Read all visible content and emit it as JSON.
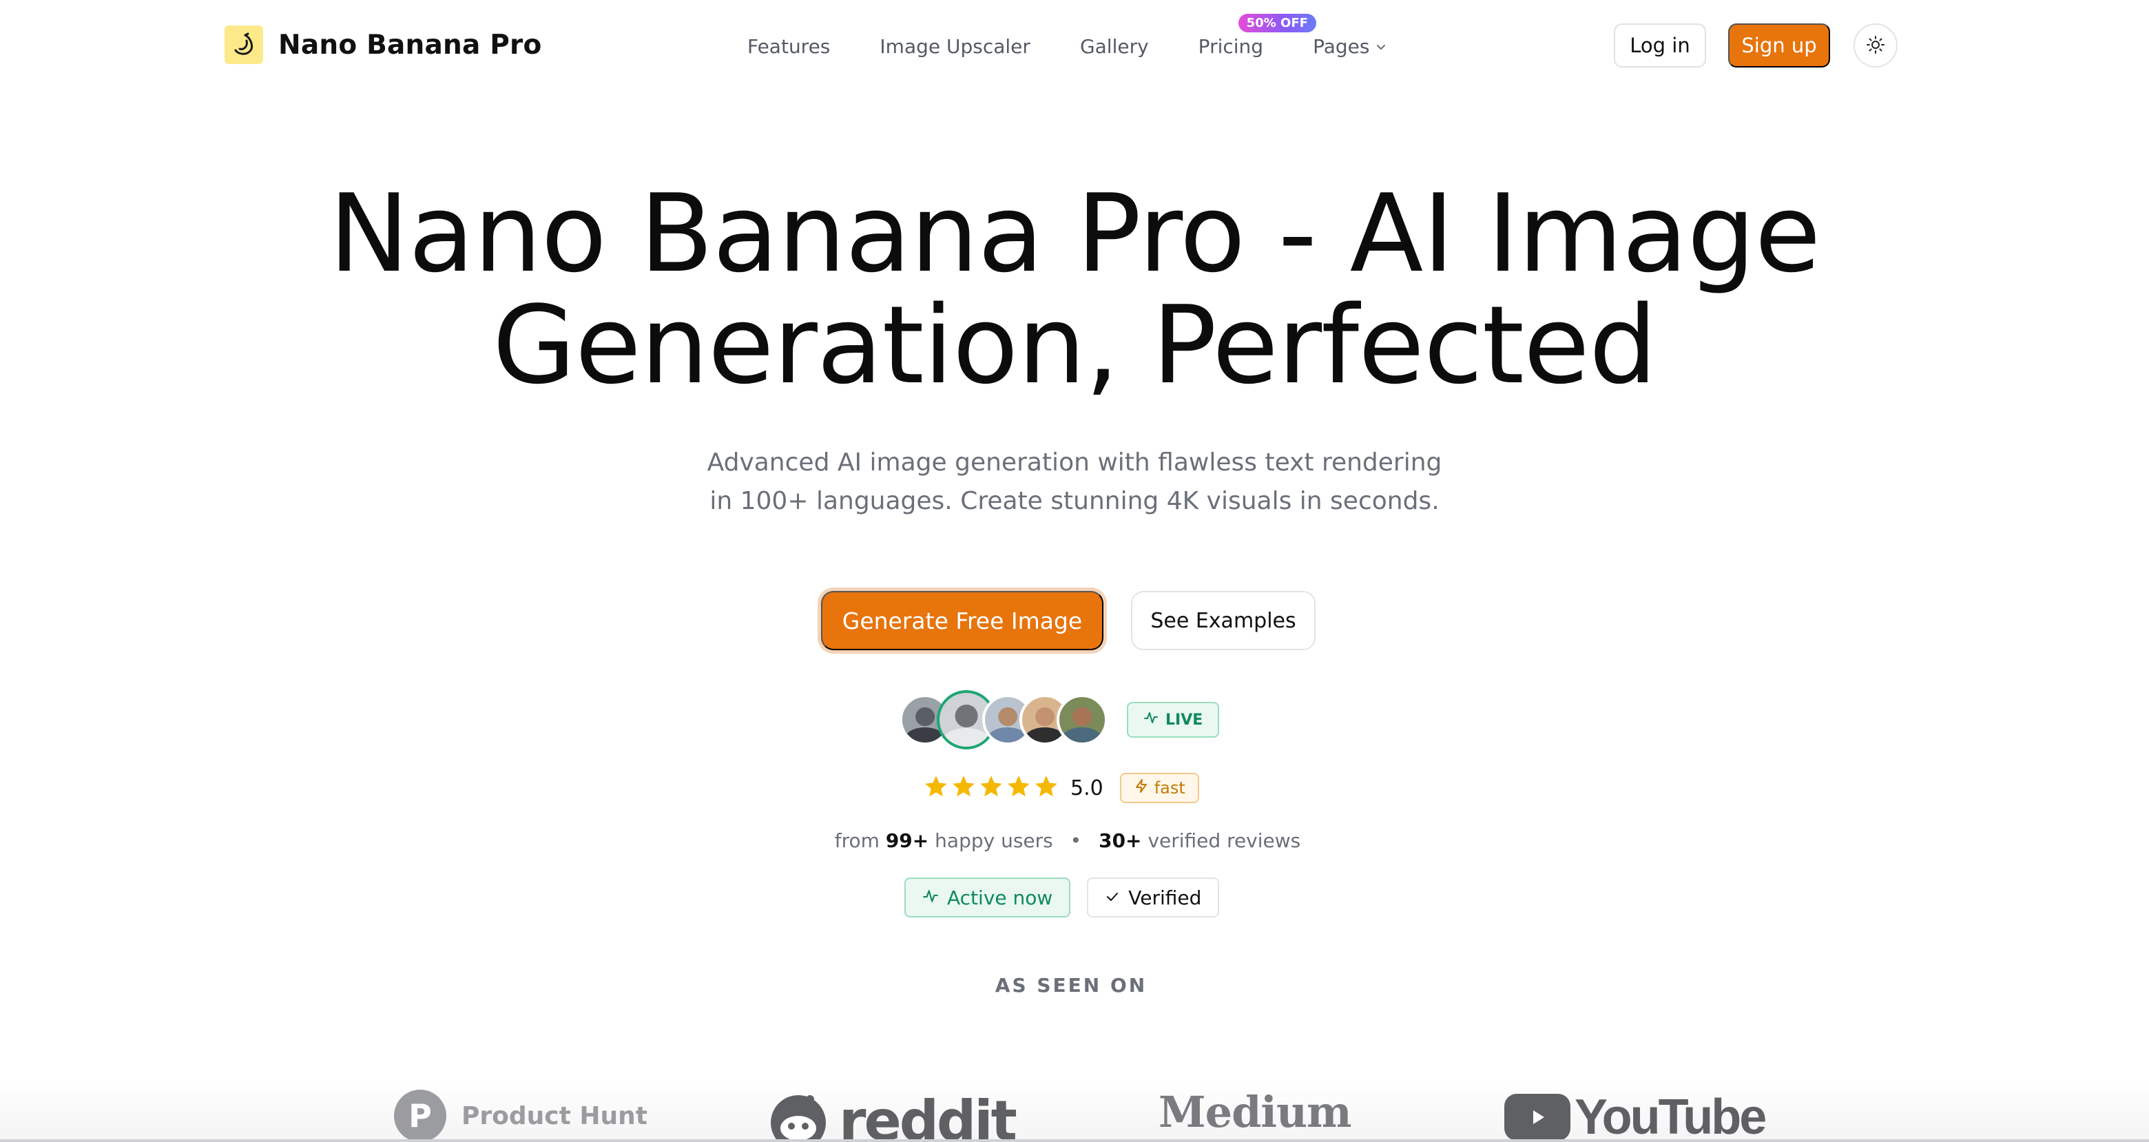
{
  "brand": {
    "name": "Nano Banana Pro"
  },
  "nav": {
    "links": [
      {
        "label": "Features"
      },
      {
        "label": "Image Upscaler"
      },
      {
        "label": "Gallery"
      },
      {
        "label": "Pricing",
        "badge": "50% OFF"
      },
      {
        "label": "Pages",
        "has_dropdown": true
      }
    ],
    "login_label": "Log in",
    "signup_label": "Sign up",
    "theme_icon": "sun-icon"
  },
  "hero": {
    "title_line1": "Nano Banana Pro - AI Image",
    "title_line2": "Generation, Perfected",
    "subtitle_line1": "Advanced AI image generation with flawless text rendering",
    "subtitle_line2": "in 100+ languages. Create stunning 4K visuals in seconds.",
    "cta_primary": "Generate Free Image",
    "cta_secondary": "See Examples"
  },
  "social_proof": {
    "live_label": "LIVE",
    "rating": "5.0",
    "stars": 5,
    "fast_label": "fast",
    "users_prefix": "from",
    "users_count": "99+",
    "users_suffix": "happy users",
    "separator": "•",
    "reviews_count": "30+",
    "reviews_suffix": "verified reviews",
    "active_label": "Active now",
    "verified_label": "Verified"
  },
  "as_seen_on": {
    "heading": "AS SEEN ON",
    "logos": [
      {
        "name": "Product Hunt",
        "mark": "P"
      },
      {
        "name": "reddit"
      },
      {
        "name": "Medium"
      },
      {
        "name": "YouTube"
      }
    ]
  },
  "colors": {
    "accent": "#e8740c",
    "live_green": "#0f8a5a",
    "star_yellow": "#f5b800",
    "badge_gradient_start": "#e64bd8",
    "badge_gradient_end": "#6b7bf7"
  }
}
